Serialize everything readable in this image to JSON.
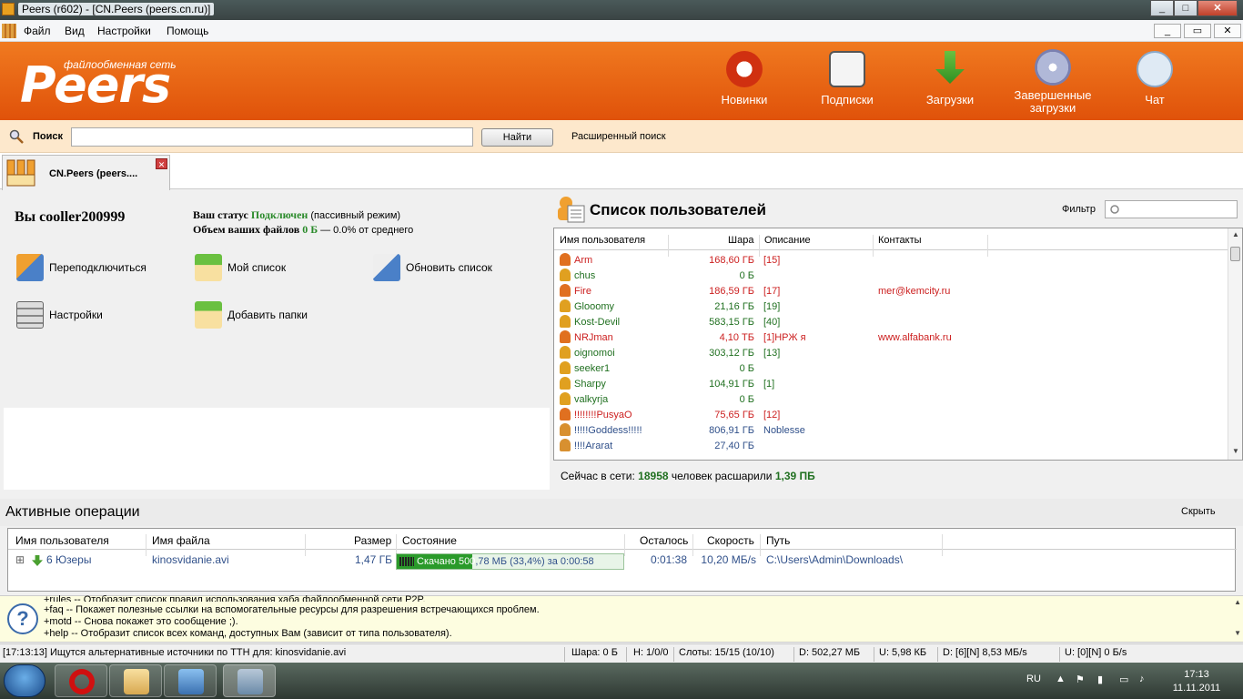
{
  "window": {
    "title": "Peers (r602) - [CN.Peers (peers.cn.ru)]",
    "minimize": "_",
    "maximize": "□",
    "close": "✕"
  },
  "menu": {
    "items": [
      "Файл",
      "Вид",
      "Настройки",
      "Помощь"
    ],
    "mdi_min": "_",
    "mdi_restore": "▭",
    "mdi_close": "✕"
  },
  "banner": {
    "logo_sub": "файлообменная сеть",
    "logo_main": "Peers",
    "nav": [
      {
        "label": "Новинки",
        "icon": "new-icon"
      },
      {
        "label": "Подписки",
        "icon": "subscriptions-icon"
      },
      {
        "label": "Загрузки",
        "icon": "download-icon"
      },
      {
        "label": "Завершенные загрузки",
        "icon": "completed-downloads-icon"
      },
      {
        "label": "Чат",
        "icon": "chat-icon"
      }
    ]
  },
  "search": {
    "label": "Поиск",
    "value": "",
    "button": "Найти",
    "advanced": "Расширенный поиск"
  },
  "tab": {
    "label": "CN.Peers (peers...."
  },
  "hub": {
    "you": "Вы cooller200999",
    "status_label": "Ваш статус",
    "status_value": "Подключен",
    "status_note": "(пассивный режим)",
    "files_label": "Объем ваших файлов",
    "files_value": "0 Б",
    "files_note": "— 0.0% от среднего",
    "actions": [
      "Переподключиться",
      "Мой список",
      "Обновить список",
      "Настройки",
      "Добавить папки"
    ]
  },
  "users": {
    "title": "Список пользователей",
    "filter_label": "Фильтр",
    "filter_value": "",
    "columns": [
      "Имя пользователя",
      "Шара",
      "Описание",
      "Контакты"
    ],
    "rows": [
      {
        "name": "Arm",
        "share": "168,60 ГБ",
        "desc": "[15]",
        "contact": "",
        "color": "red"
      },
      {
        "name": "chus",
        "share": "0 Б",
        "desc": "",
        "contact": "",
        "color": "green"
      },
      {
        "name": "Fire",
        "share": "186,59 ГБ",
        "desc": "[17]",
        "contact": "mer@kemcity.ru",
        "color": "red"
      },
      {
        "name": "Glooomy",
        "share": "21,16 ГБ",
        "desc": "[19]",
        "contact": "",
        "color": "green"
      },
      {
        "name": "Kost-Devil",
        "share": "583,15 ГБ",
        "desc": "[40]",
        "contact": "",
        "color": "green"
      },
      {
        "name": "NRJman",
        "share": "4,10 ТБ",
        "desc": "[1]НРЖ я",
        "contact": "www.alfabank.ru",
        "color": "red"
      },
      {
        "name": "oignomoi",
        "share": "303,12 ГБ",
        "desc": "[13]",
        "contact": "",
        "color": "green"
      },
      {
        "name": "seeker1",
        "share": "0 Б",
        "desc": "",
        "contact": "",
        "color": "green"
      },
      {
        "name": "Sharpy",
        "share": "104,91 ГБ",
        "desc": "[1]",
        "contact": "",
        "color": "green"
      },
      {
        "name": "valkyrja",
        "share": "0 Б",
        "desc": "",
        "contact": "",
        "color": "green"
      },
      {
        "name": "!!!!!!!!PusyaO",
        "share": "75,65 ГБ",
        "desc": "[12]",
        "contact": "",
        "color": "red"
      },
      {
        "name": "!!!!!Goddess!!!!!",
        "share": "806,91 ГБ",
        "desc": "Noblesse",
        "contact": "",
        "color": "blue"
      },
      {
        "name": "!!!!Ararat",
        "share": "27,40 ГБ",
        "desc": "",
        "contact": "",
        "color": "blue"
      }
    ],
    "online_prefix": "Сейчас в сети:",
    "online_count": "18958",
    "online_mid": "человек расшарили",
    "online_share": "1,39 ПБ"
  },
  "active_ops": {
    "title": "Активные операции",
    "hide": "Скрыть",
    "columns": [
      "Имя пользователя",
      "Имя файла",
      "Размер",
      "Состояние",
      "Осталось",
      "Скорость",
      "Путь"
    ],
    "row": {
      "expand": "⊞",
      "user": "6 Юзеры",
      "file": "kinosvidanie.avi",
      "size": "1,47 ГБ",
      "state_on": "Скачано 500",
      "state_off": ",78 МБ (33,4%) за 0:00:58",
      "progress": 0.334,
      "left": "0:01:38",
      "speed": "10,20 МБ/s",
      "path": "C:\\Users\\Admin\\Downloads\\"
    }
  },
  "info": {
    "lines": [
      "+rules  -- Отобразит список правил использования хаба файлообменной сети P2P.",
      "+faq   -- Покажет полезные ссылки на вспомогательные ресурсы для разрешения встречающихся проблем.",
      "+motd   -- Снова покажет это сообщение ;).",
      "+help   -- Отобразит список всех команд, доступных Вам (зависит от типа пользователя)."
    ]
  },
  "statusbar": {
    "message": "[17:13:13] Ищутся альтернативные источники по TTH для: kinosvidanie.avi",
    "share": "Шара: 0 Б",
    "hubs": "H: 1/0/0",
    "slots": "Слоты: 15/15 (10/10)",
    "down": "D: 502,27 МБ",
    "up": "U: 5,98 КБ",
    "down_rate": "D: [6][N] 8,53 МБ/s",
    "up_rate": "U: [0][N] 0 Б/s"
  },
  "taskbar": {
    "lang": "RU",
    "time": "17:13",
    "date": "11.11.2011"
  }
}
